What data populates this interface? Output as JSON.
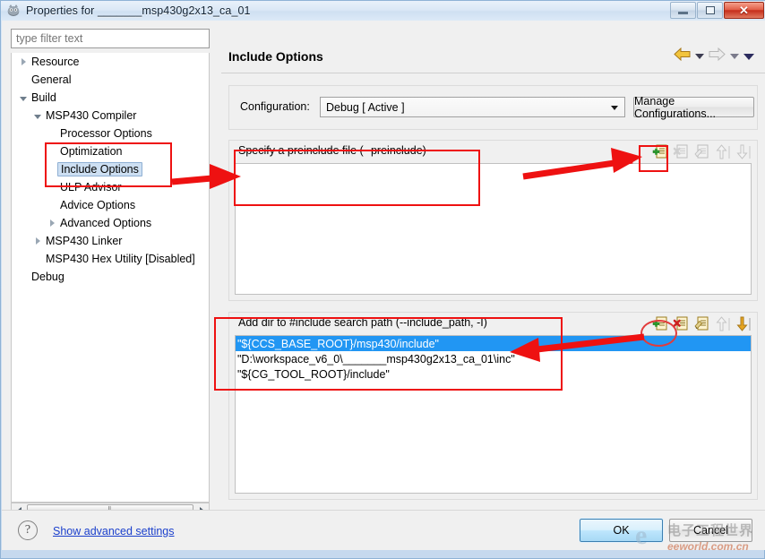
{
  "window": {
    "title": "Properties for _______msp430g2x13_ca_01",
    "app_icon": "properties-dialog-icon",
    "controls": {
      "minimize": "Minimize",
      "maximize": "Maximize",
      "close": "✕"
    }
  },
  "sidebar": {
    "filter": {
      "placeholder": "type filter text",
      "value": ""
    },
    "items": [
      {
        "label": "Resource",
        "indent": 1,
        "twisty": "closed",
        "selected": false
      },
      {
        "label": "General",
        "indent": 1,
        "twisty": "none",
        "selected": false
      },
      {
        "label": "Build",
        "indent": 1,
        "twisty": "open",
        "selected": false
      },
      {
        "label": "MSP430 Compiler",
        "indent": 2,
        "twisty": "open",
        "selected": false
      },
      {
        "label": "Processor Options",
        "indent": 3,
        "twisty": "none",
        "selected": false
      },
      {
        "label": "Optimization",
        "indent": 3,
        "twisty": "none",
        "selected": false
      },
      {
        "label": "Include Options",
        "indent": 3,
        "twisty": "none",
        "selected": true
      },
      {
        "label": "ULP Advisor",
        "indent": 3,
        "twisty": "none",
        "selected": false
      },
      {
        "label": "Advice Options",
        "indent": 3,
        "twisty": "none",
        "selected": false
      },
      {
        "label": "Advanced Options",
        "indent": 3,
        "twisty": "closed",
        "selected": false
      },
      {
        "label": "MSP430 Linker",
        "indent": 2,
        "twisty": "closed",
        "selected": false
      },
      {
        "label": "MSP430 Hex Utility  [Disabled]",
        "indent": 2,
        "twisty": "none",
        "selected": false
      },
      {
        "label": "Debug",
        "indent": 1,
        "twisty": "none",
        "selected": false
      }
    ],
    "hscroll_grip": "‖‖"
  },
  "page": {
    "title": "Include Options",
    "nav": {
      "back_icon": "back-arrow-icon",
      "back_menu_icon": "chevron-down-icon",
      "forward_icon": "forward-arrow-icon",
      "forward_menu_icon": "chevron-down-icon",
      "view_menu_icon": "chevron-down-icon"
    },
    "configuration": {
      "label": "Configuration:",
      "selected": "Debug  [ Active ]",
      "options": [
        "Debug  [ Active ]"
      ],
      "manage_button": "Manage Configurations..."
    },
    "preinclude": {
      "title": "Specify a preinclude file (--preinclude)",
      "rows": [],
      "toolbar": [
        {
          "name": "add-icon",
          "enabled": true
        },
        {
          "name": "delete-icon",
          "enabled": false
        },
        {
          "name": "edit-icon",
          "enabled": false
        },
        {
          "name": "move-up-icon",
          "enabled": false
        },
        {
          "name": "move-down-icon",
          "enabled": false
        }
      ]
    },
    "search_path": {
      "title": "Add dir to #include search path (--include_path, -I)",
      "rows": [
        {
          "value": "\"${CCS_BASE_ROOT}/msp430/include\"",
          "selected": true
        },
        {
          "value": "\"D:\\workspace_v6_0\\_______msp430g2x13_ca_01\\inc\"",
          "selected": false
        },
        {
          "value": "\"${CG_TOOL_ROOT}/include\"",
          "selected": false
        }
      ],
      "toolbar": [
        {
          "name": "add-icon",
          "enabled": true
        },
        {
          "name": "delete-icon",
          "enabled": true
        },
        {
          "name": "edit-icon",
          "enabled": true
        },
        {
          "name": "move-up-icon",
          "enabled": false
        },
        {
          "name": "move-down-icon",
          "enabled": true
        }
      ]
    }
  },
  "footer": {
    "help_icon": "help-question-icon",
    "advanced_link": "Show advanced settings",
    "ok_button": "OK",
    "cancel_button": "Cancel"
  },
  "watermark": {
    "logo": "e",
    "chinese": "电子工程世界",
    "site": "eeworld.com.cn"
  },
  "colors": {
    "selection_blue": "#2196f3",
    "tree_selection": "#cddff2",
    "annotation_red": "#ee1111",
    "link_blue": "#1a3fcc",
    "ok_focus": "#3c7fb1"
  }
}
